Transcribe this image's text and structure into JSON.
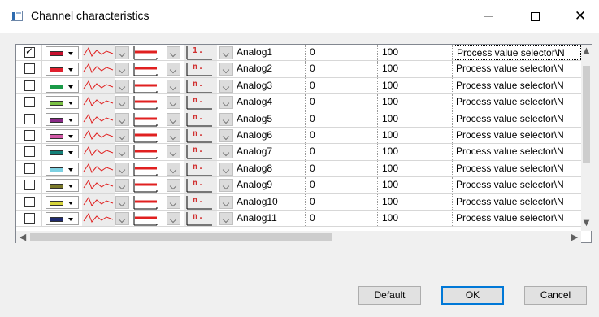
{
  "window": {
    "title": "Channel characteristics",
    "icon": "window-app-icon",
    "controls": {
      "minimize": "minimize-icon",
      "maximize": "maximize-icon",
      "close": "close-icon",
      "close_glyph": "✕"
    }
  },
  "grid": {
    "check_glyph": "✓",
    "rows": [
      {
        "checked": true,
        "color": "#c8102e",
        "marker": "1.",
        "name": "Analog1",
        "min": "0",
        "max": "100",
        "selector": "Process value selector\\N"
      },
      {
        "checked": false,
        "color": "#e0202e",
        "marker": "n.",
        "name": "Analog2",
        "min": "0",
        "max": "100",
        "selector": "Process value selector\\N"
      },
      {
        "checked": false,
        "color": "#1a9a48",
        "marker": "n.",
        "name": "Analog3",
        "min": "0",
        "max": "100",
        "selector": "Process value selector\\N"
      },
      {
        "checked": false,
        "color": "#7ac143",
        "marker": "n.",
        "name": "Analog4",
        "min": "0",
        "max": "100",
        "selector": "Process value selector\\N"
      },
      {
        "checked": false,
        "color": "#8a2a88",
        "marker": "n.",
        "name": "Analog5",
        "min": "0",
        "max": "100",
        "selector": "Process value selector\\N"
      },
      {
        "checked": false,
        "color": "#d35aa8",
        "marker": "n.",
        "name": "Analog6",
        "min": "0",
        "max": "100",
        "selector": "Process value selector\\N"
      },
      {
        "checked": false,
        "color": "#138078",
        "marker": "n.",
        "name": "Analog7",
        "min": "0",
        "max": "100",
        "selector": "Process value selector\\N"
      },
      {
        "checked": false,
        "color": "#7dd1e2",
        "marker": "n.",
        "name": "Analog8",
        "min": "0",
        "max": "100",
        "selector": "Process value selector\\N"
      },
      {
        "checked": false,
        "color": "#7c7a2a",
        "marker": "n.",
        "name": "Analog9",
        "min": "0",
        "max": "100",
        "selector": "Process value selector\\N"
      },
      {
        "checked": false,
        "color": "#d6d43a",
        "marker": "n.",
        "name": "Analog10",
        "min": "0",
        "max": "100",
        "selector": "Process value selector\\N"
      },
      {
        "checked": false,
        "color": "#1f2a6e",
        "marker": "n.",
        "name": "Analog11",
        "min": "0",
        "max": "100",
        "selector": "Process value selector\\N"
      }
    ],
    "line_color": "#e02020",
    "scroll_glyphs": {
      "up": "▲",
      "down": "▼",
      "left": "◀",
      "right": "▶"
    }
  },
  "buttons": {
    "default": "Default",
    "ok": "OK",
    "cancel": "Cancel"
  }
}
